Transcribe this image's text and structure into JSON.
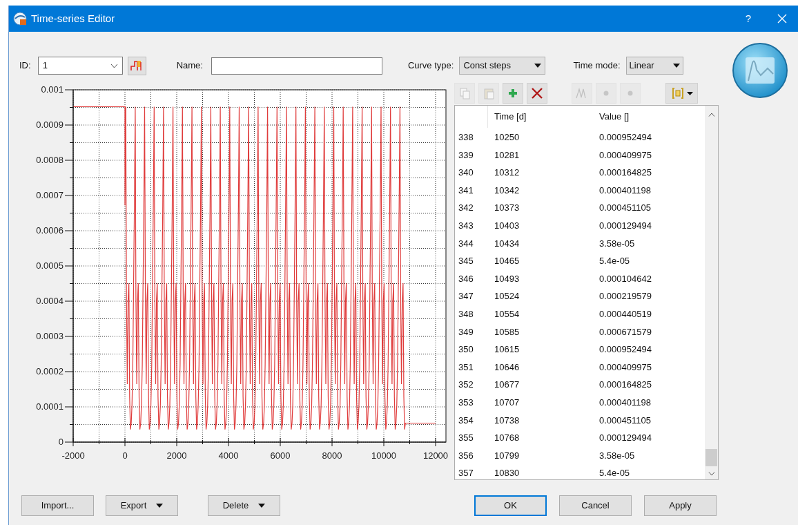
{
  "window": {
    "title": "Time-series Editor",
    "help": "?"
  },
  "form": {
    "id_label": "ID:",
    "id_value": "1",
    "name_label": "Name:",
    "curve_type_label": "Curve type:",
    "curve_type": "Const steps",
    "time_mode_label": "Time mode:",
    "time_mode": "Linear"
  },
  "toolbar": [
    [
      {
        "kind": "copy",
        "disabled": true
      },
      {
        "kind": "paste",
        "disabled": true
      },
      {
        "kind": "add",
        "disabled": false
      },
      {
        "kind": "delete",
        "disabled": false
      }
    ],
    [
      {
        "kind": "peaks",
        "disabled": true
      },
      {
        "kind": "dot",
        "disabled": true
      },
      {
        "kind": "dot",
        "disabled": true
      }
    ],
    [
      {
        "kind": "format",
        "disabled": false
      }
    ]
  ],
  "chart": {
    "chart_data": {
      "type": "line",
      "xlim": [
        -2000,
        12400
      ],
      "ylim": [
        0,
        0.001
      ],
      "xticks": [
        -2000,
        0,
        2000,
        4000,
        6000,
        8000,
        10000,
        12000
      ],
      "yticks": [
        0,
        0.0001,
        0.0002,
        0.0003,
        0.0004,
        0.0005,
        0.0006,
        0.0007,
        0.0008,
        0.0009,
        0.001
      ],
      "grid": true,
      "x": [
        -2000,
        0,
        0,
        31,
        59,
        90,
        120,
        151,
        181,
        212,
        243,
        273,
        304,
        334,
        365,
        396,
        424,
        455,
        485,
        516,
        546,
        577,
        608,
        638,
        669,
        699,
        730,
        761,
        789,
        820,
        850,
        881,
        911,
        942,
        973,
        1003,
        1034,
        1064,
        1096,
        1127,
        1155,
        1186,
        1216,
        1247,
        1277,
        1308,
        1339,
        1369,
        1400,
        1430,
        1461,
        1492,
        1520,
        1551,
        1581,
        1612,
        1642,
        1673,
        1704,
        1734,
        1765,
        1795,
        1826,
        1857,
        1885,
        1916,
        1946,
        1977,
        2007,
        2038,
        2069,
        2099,
        2130,
        2160,
        2191,
        2222,
        2250,
        2281,
        2311,
        2342,
        2372,
        2403,
        2434,
        2464,
        2495,
        2525,
        2557,
        2588,
        2616,
        2647,
        2677,
        2708,
        2738,
        2769,
        2800,
        2830,
        2861,
        2891,
        2922,
        2953,
        2981,
        3012,
        3042,
        3073,
        3103,
        3134,
        3165,
        3195,
        3226,
        3256,
        3287,
        3318,
        3346,
        3377,
        3407,
        3438,
        3468,
        3499,
        3530,
        3560,
        3591,
        3621,
        3652,
        3683,
        3711,
        3742,
        3772,
        3803,
        3833,
        3864,
        3895,
        3925,
        3956,
        3986,
        4018,
        4049,
        4077,
        4108,
        4138,
        4169,
        4199,
        4230,
        4261,
        4291,
        4322,
        4352,
        4383,
        4414,
        4442,
        4473,
        4503,
        4534,
        4564,
        4595,
        4626,
        4656,
        4687,
        4717,
        4748,
        4779,
        4807,
        4838,
        4868,
        4899,
        4929,
        4960,
        4991,
        5021,
        5052,
        5082,
        5113,
        5144,
        5172,
        5203,
        5233,
        5264,
        5294,
        5325,
        5356,
        5386,
        5417,
        5447,
        5479,
        5510,
        5538,
        5569,
        5599,
        5630,
        5660,
        5691,
        5722,
        5752,
        5783,
        5813,
        5844,
        5875,
        5903,
        5934,
        5964,
        5995,
        6025,
        6056,
        6087,
        6117,
        6148,
        6178,
        6209,
        6240,
        6268,
        6299,
        6329,
        6360,
        6390,
        6421,
        6452,
        6482,
        6513,
        6543,
        6574,
        6605,
        6633,
        6664,
        6694,
        6725,
        6755,
        6786,
        6817,
        6847,
        6878,
        6908,
        6940,
        6971,
        6999,
        7030,
        7060,
        7091,
        7121,
        7152,
        7183,
        7213,
        7244,
        7274,
        7305,
        7336,
        7364,
        7395,
        7425,
        7456,
        7486,
        7517,
        7548,
        7578,
        7609,
        7639,
        7670,
        7701,
        7729,
        7760,
        7790,
        7821,
        7851,
        7882,
        7913,
        7943,
        7974,
        8004,
        8035,
        8066,
        8094,
        8125,
        8155,
        8186,
        8216,
        8247,
        8278,
        8308,
        8339,
        8369,
        8401,
        8432,
        8460,
        8491,
        8521,
        8552,
        8582,
        8613,
        8644,
        8674,
        8705,
        8735,
        8766,
        8797,
        8825,
        8856,
        8886,
        8917,
        8947,
        8978,
        9009,
        9039,
        9070,
        9100,
        9131,
        9162,
        9190,
        9221,
        9251,
        9282,
        9312,
        9343,
        9374,
        9404,
        9435,
        9465,
        9496,
        9527,
        9555,
        9586,
        9616,
        9647,
        9677,
        9708,
        9739,
        9769,
        9800,
        9830,
        9862,
        9893,
        9921,
        9952,
        9982,
        10013,
        10043,
        10074,
        10105,
        10135,
        10166,
        10196,
        10227,
        10258,
        10286,
        10317,
        10347,
        10378,
        10408,
        10439,
        10470,
        10500,
        10531,
        10561,
        10592,
        10623,
        10651,
        10682,
        10712,
        10743,
        10773,
        10804,
        10835,
        12000
      ],
      "series": [
        {
          "color": "#e03c3c",
          "values": [
            0.000952,
            0.000952,
            0.000672,
            0.000952,
            0.00041,
            0.000165,
            0.000401,
            0.000451,
            0.000129,
            3.58e-05,
            5.4e-05,
            0.000105,
            0.00022,
            0.000441,
            0.000672,
            0.000952,
            0.00041,
            0.000165,
            0.000401,
            0.000451,
            0.000129,
            3.58e-05,
            5.4e-05,
            0.000105,
            0.00022,
            0.000441,
            0.000672,
            0.000952,
            0.00041,
            0.000165,
            0.000401,
            0.000451,
            0.000129,
            3.58e-05,
            5.4e-05,
            0.000105,
            0.00022,
            0.000441,
            0.000672,
            0.000952,
            0.00041,
            0.000165,
            0.000401,
            0.000451,
            0.000129,
            3.58e-05,
            5.4e-05,
            0.000105,
            0.00022,
            0.000441,
            0.000672,
            0.000952,
            0.00041,
            0.000165,
            0.000401,
            0.000451,
            0.000129,
            3.58e-05,
            5.4e-05,
            0.000105,
            0.00022,
            0.000441,
            0.000672,
            0.000952,
            0.00041,
            0.000165,
            0.000401,
            0.000451,
            0.000129,
            3.58e-05,
            5.4e-05,
            0.000105,
            0.00022,
            0.000441,
            0.000672,
            0.000952,
            0.00041,
            0.000165,
            0.000401,
            0.000451,
            0.000129,
            3.58e-05,
            5.4e-05,
            0.000105,
            0.00022,
            0.000441,
            0.000672,
            0.000952,
            0.00041,
            0.000165,
            0.000401,
            0.000451,
            0.000129,
            3.58e-05,
            5.4e-05,
            0.000105,
            0.00022,
            0.000441,
            0.000672,
            0.000952,
            0.00041,
            0.000165,
            0.000401,
            0.000451,
            0.000129,
            3.58e-05,
            5.4e-05,
            0.000105,
            0.00022,
            0.000441,
            0.000672,
            0.000952,
            0.00041,
            0.000165,
            0.000401,
            0.000451,
            0.000129,
            3.58e-05,
            5.4e-05,
            0.000105,
            0.00022,
            0.000441,
            0.000672,
            0.000952,
            0.00041,
            0.000165,
            0.000401,
            0.000451,
            0.000129,
            3.58e-05,
            5.4e-05,
            0.000105,
            0.00022,
            0.000441,
            0.000672,
            0.000952,
            0.00041,
            0.000165,
            0.000401,
            0.000451,
            0.000129,
            3.58e-05,
            5.4e-05,
            0.000105,
            0.00022,
            0.000441,
            0.000672,
            0.000952,
            0.00041,
            0.000165,
            0.000401,
            0.000451,
            0.000129,
            3.58e-05,
            5.4e-05,
            0.000105,
            0.00022,
            0.000441,
            0.000672,
            0.000952,
            0.00041,
            0.000165,
            0.000401,
            0.000451,
            0.000129,
            3.58e-05,
            5.4e-05,
            0.000105,
            0.00022,
            0.000441,
            0.000672,
            0.000952,
            0.00041,
            0.000165,
            0.000401,
            0.000451,
            0.000129,
            3.58e-05,
            5.4e-05,
            0.000105,
            0.00022,
            0.000441,
            0.000672,
            0.000952,
            0.00041,
            0.000165,
            0.000401,
            0.000451,
            0.000129,
            3.58e-05,
            5.4e-05,
            0.000105,
            0.00022,
            0.000441,
            0.000672,
            0.000952,
            0.00041,
            0.000165,
            0.000401,
            0.000451,
            0.000129,
            3.58e-05,
            5.4e-05,
            0.000105,
            0.00022,
            0.000441,
            0.000672,
            0.000952,
            0.00041,
            0.000165,
            0.000401,
            0.000451,
            0.000129,
            3.58e-05,
            5.4e-05,
            0.000105,
            0.00022,
            0.000441,
            0.000672,
            0.000952,
            0.00041,
            0.000165,
            0.000401,
            0.000451,
            0.000129,
            3.58e-05,
            5.4e-05,
            0.000105,
            0.00022,
            0.000441,
            0.000672,
            0.000952,
            0.00041,
            0.000165,
            0.000401,
            0.000451,
            0.000129,
            3.58e-05,
            5.4e-05,
            0.000105,
            0.00022,
            0.000441,
            0.000672,
            0.000952,
            0.00041,
            0.000165,
            0.000401,
            0.000451,
            0.000129,
            3.58e-05,
            5.4e-05,
            0.000105,
            0.00022,
            0.000441,
            0.000672,
            0.000952,
            0.00041,
            0.000165,
            0.000401,
            0.000451,
            0.000129,
            3.58e-05,
            5.4e-05,
            0.000105,
            0.00022,
            0.000441,
            0.000672,
            0.000952,
            0.00041,
            0.000165,
            0.000401,
            0.000451,
            0.000129,
            3.58e-05,
            5.4e-05,
            0.000105,
            0.00022,
            0.000441,
            0.000672,
            0.000952,
            0.00041,
            0.000165,
            0.000401,
            0.000451,
            0.000129,
            3.58e-05,
            5.4e-05,
            0.000105,
            0.00022,
            0.000441,
            0.000672,
            0.000952,
            0.00041,
            0.000165,
            0.000401,
            0.000451,
            0.000129,
            3.58e-05,
            5.4e-05,
            0.000105,
            0.00022,
            0.000441,
            0.000672,
            0.000952,
            0.00041,
            0.000165,
            0.000401,
            0.000451,
            0.000129,
            3.58e-05,
            5.4e-05,
            0.000105,
            0.00022,
            0.000441,
            0.000672,
            0.000952,
            0.00041,
            0.000165,
            0.000401,
            0.000451,
            0.000129,
            3.58e-05,
            5.4e-05,
            0.000105,
            0.00022,
            0.000441,
            0.000672,
            0.000952,
            0.00041,
            0.000165,
            0.000401,
            0.000451,
            0.000129,
            3.58e-05,
            5.4e-05,
            0.000105,
            0.00022,
            0.000441,
            0.000672,
            0.000952,
            0.00041,
            0.000165,
            0.000401,
            0.000451,
            0.000129,
            3.58e-05,
            5.4e-05,
            0.000105,
            0.00022,
            0.000441,
            0.000672,
            0.000952,
            0.00041,
            0.000165,
            0.000401,
            0.000451,
            0.000129,
            3.58e-05,
            5.4e-05,
            5.4e-05
          ]
        }
      ]
    }
  },
  "table": {
    "columns": [
      "Time [d]",
      "Value []"
    ],
    "rows": [
      {
        "index": "338",
        "time": "10250",
        "value": "0.000952494"
      },
      {
        "index": "339",
        "time": "10281",
        "value": "0.000409975"
      },
      {
        "index": "340",
        "time": "10312",
        "value": "0.000164825"
      },
      {
        "index": "341",
        "time": "10342",
        "value": "0.000401198"
      },
      {
        "index": "342",
        "time": "10373",
        "value": "0.000451105"
      },
      {
        "index": "343",
        "time": "10403",
        "value": "0.000129494"
      },
      {
        "index": "344",
        "time": "10434",
        "value": "3.58e-05"
      },
      {
        "index": "345",
        "time": "10465",
        "value": "5.4e-05"
      },
      {
        "index": "346",
        "time": "10493",
        "value": "0.000104642"
      },
      {
        "index": "347",
        "time": "10524",
        "value": "0.000219579"
      },
      {
        "index": "348",
        "time": "10554",
        "value": "0.000440519"
      },
      {
        "index": "349",
        "time": "10585",
        "value": "0.000671579"
      },
      {
        "index": "350",
        "time": "10615",
        "value": "0.000952494"
      },
      {
        "index": "351",
        "time": "10646",
        "value": "0.000409975"
      },
      {
        "index": "352",
        "time": "10677",
        "value": "0.000164825"
      },
      {
        "index": "353",
        "time": "10707",
        "value": "0.000401198"
      },
      {
        "index": "354",
        "time": "10738",
        "value": "0.000451105"
      },
      {
        "index": "355",
        "time": "10768",
        "value": "0.000129494"
      },
      {
        "index": "356",
        "time": "10799",
        "value": "3.58e-05"
      },
      {
        "index": "357",
        "time": "10830",
        "value": "5.4e-05"
      }
    ]
  },
  "file_buttons": [
    {
      "label": "Import...",
      "dropdown": false
    },
    {
      "label": "Export",
      "dropdown": true
    },
    {
      "label": "Delete",
      "dropdown": true
    }
  ],
  "dialog_buttons": [
    {
      "label": "OK",
      "default": true
    },
    {
      "label": "Cancel",
      "default": false
    },
    {
      "label": "Apply",
      "default": false
    }
  ]
}
